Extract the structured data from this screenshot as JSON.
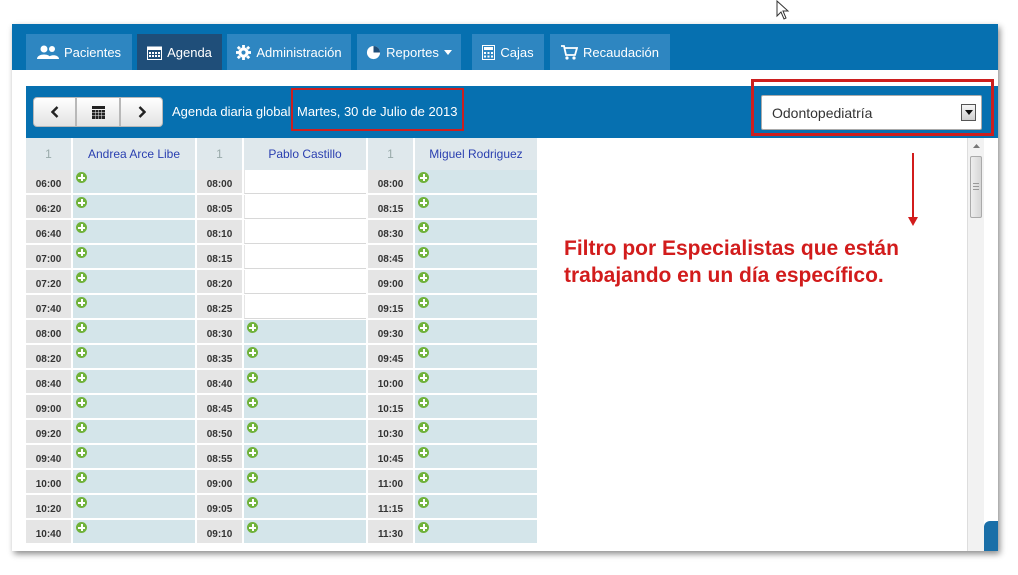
{
  "nav": {
    "items": [
      {
        "label": "Pacientes",
        "icon": "users-icon",
        "active": false
      },
      {
        "label": "Agenda",
        "icon": "calendar-icon",
        "active": true
      },
      {
        "label": "Administración",
        "icon": "gear-icon",
        "active": false
      },
      {
        "label": "Reportes",
        "icon": "pie-chart-icon",
        "active": false,
        "dropdown": true
      },
      {
        "label": "Cajas",
        "icon": "calculator-icon",
        "active": false
      },
      {
        "label": "Recaudación",
        "icon": "cart-icon",
        "active": false
      }
    ]
  },
  "toolbar": {
    "agenda_label": "Agenda diaria global.",
    "date": "Martes, 30 de Julio de 2013",
    "specialty_select": {
      "value": "Odontopediatría"
    }
  },
  "agenda": {
    "columns": [
      {
        "num": "1",
        "name": "Andrea Arce Libe",
        "slots": [
          {
            "time": "06:00",
            "free": true
          },
          {
            "time": "06:20",
            "free": true
          },
          {
            "time": "06:40",
            "free": true
          },
          {
            "time": "07:00",
            "free": true
          },
          {
            "time": "07:20",
            "free": true
          },
          {
            "time": "07:40",
            "free": true
          },
          {
            "time": "08:00",
            "free": true
          },
          {
            "time": "08:20",
            "free": true
          },
          {
            "time": "08:40",
            "free": true
          },
          {
            "time": "09:00",
            "free": true
          },
          {
            "time": "09:20",
            "free": true
          },
          {
            "time": "09:40",
            "free": true
          },
          {
            "time": "10:00",
            "free": true
          },
          {
            "time": "10:20",
            "free": true
          },
          {
            "time": "10:40",
            "free": true
          }
        ]
      },
      {
        "num": "1",
        "name": "Pablo Castillo",
        "slots": [
          {
            "time": "08:00",
            "free": false
          },
          {
            "time": "08:05",
            "free": false
          },
          {
            "time": "08:10",
            "free": false
          },
          {
            "time": "08:15",
            "free": false
          },
          {
            "time": "08:20",
            "free": false
          },
          {
            "time": "08:25",
            "free": false
          },
          {
            "time": "08:30",
            "free": true
          },
          {
            "time": "08:35",
            "free": true
          },
          {
            "time": "08:40",
            "free": true
          },
          {
            "time": "08:45",
            "free": true
          },
          {
            "time": "08:50",
            "free": true
          },
          {
            "time": "08:55",
            "free": true
          },
          {
            "time": "09:00",
            "free": true
          },
          {
            "time": "09:05",
            "free": true
          },
          {
            "time": "09:10",
            "free": true
          }
        ]
      },
      {
        "num": "1",
        "name": "Miguel Rodriguez",
        "slots": [
          {
            "time": "08:00",
            "free": true
          },
          {
            "time": "08:15",
            "free": true
          },
          {
            "time": "08:30",
            "free": true
          },
          {
            "time": "08:45",
            "free": true
          },
          {
            "time": "09:00",
            "free": true
          },
          {
            "time": "09:15",
            "free": true
          },
          {
            "time": "09:30",
            "free": true
          },
          {
            "time": "09:45",
            "free": true
          },
          {
            "time": "10:00",
            "free": true
          },
          {
            "time": "10:15",
            "free": true
          },
          {
            "time": "10:30",
            "free": true
          },
          {
            "time": "10:45",
            "free": true
          },
          {
            "time": "11:00",
            "free": true
          },
          {
            "time": "11:15",
            "free": true
          },
          {
            "time": "11:30",
            "free": true
          }
        ]
      }
    ]
  },
  "annotation": {
    "line1": "Filtro por Especialistas que están",
    "line2": "trabajando en un día específico."
  },
  "colors": {
    "navbar": "#0670b0",
    "nav_active": "#1f4e79",
    "free_slot": "#d4e5ea",
    "annotation": "#d21c1c",
    "add_icon": "#6fb23a"
  }
}
